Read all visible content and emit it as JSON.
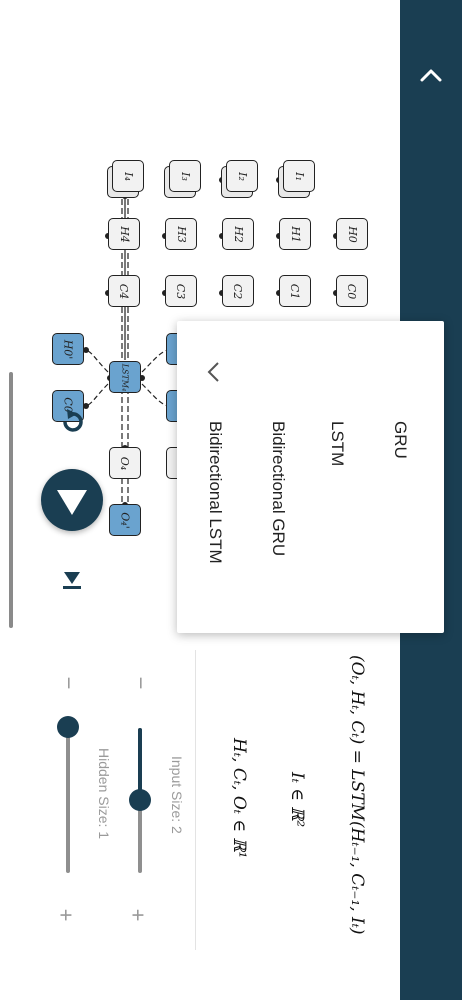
{
  "header": {
    "collapse_icon": "chevron-up-icon"
  },
  "menu": {
    "items": [
      "GRU",
      "LSTM",
      "Bidirectional GRU",
      "Bidirectional LSTM"
    ],
    "back_icon": "chevron-left-icon"
  },
  "diagram": {
    "inputs": [
      "I₁",
      "I₂",
      "I₃",
      "I₄"
    ],
    "hidden": [
      "H0",
      "H1",
      "H2",
      "H3",
      "H4"
    ],
    "cell": [
      "C0",
      "C1",
      "C2",
      "C3",
      "C4"
    ],
    "lstm_label": "LSTM₄",
    "output_prev": "O₄",
    "output_next": "O₄'",
    "hidden_next": "H0'",
    "cell_next": "C0'"
  },
  "equations": {
    "eq1": "(Oₜ, Hₜ, Cₜ) = LSTM(Hₜ₋₁, Cₜ₋₁, Iₜ)",
    "eq2": "Iₜ ∈ ℝ²",
    "eq3": "Hₜ, Cₜ, Oₜ ∈ ℝ¹"
  },
  "controls": {
    "play_icon": "play-icon",
    "skip_icon": "skip-to-end-icon",
    "reset_icon": "refresh-icon",
    "input_size_label": "Input Size: 2",
    "hidden_size_label": "Hidden Size: 1",
    "minus": "−",
    "plus": "+",
    "input_size_value": 2,
    "hidden_size_value": 1
  },
  "colors": {
    "accent": "#1a3e52",
    "node_blue": "#6aa3cf",
    "node_gray": "#f2f2f2"
  }
}
